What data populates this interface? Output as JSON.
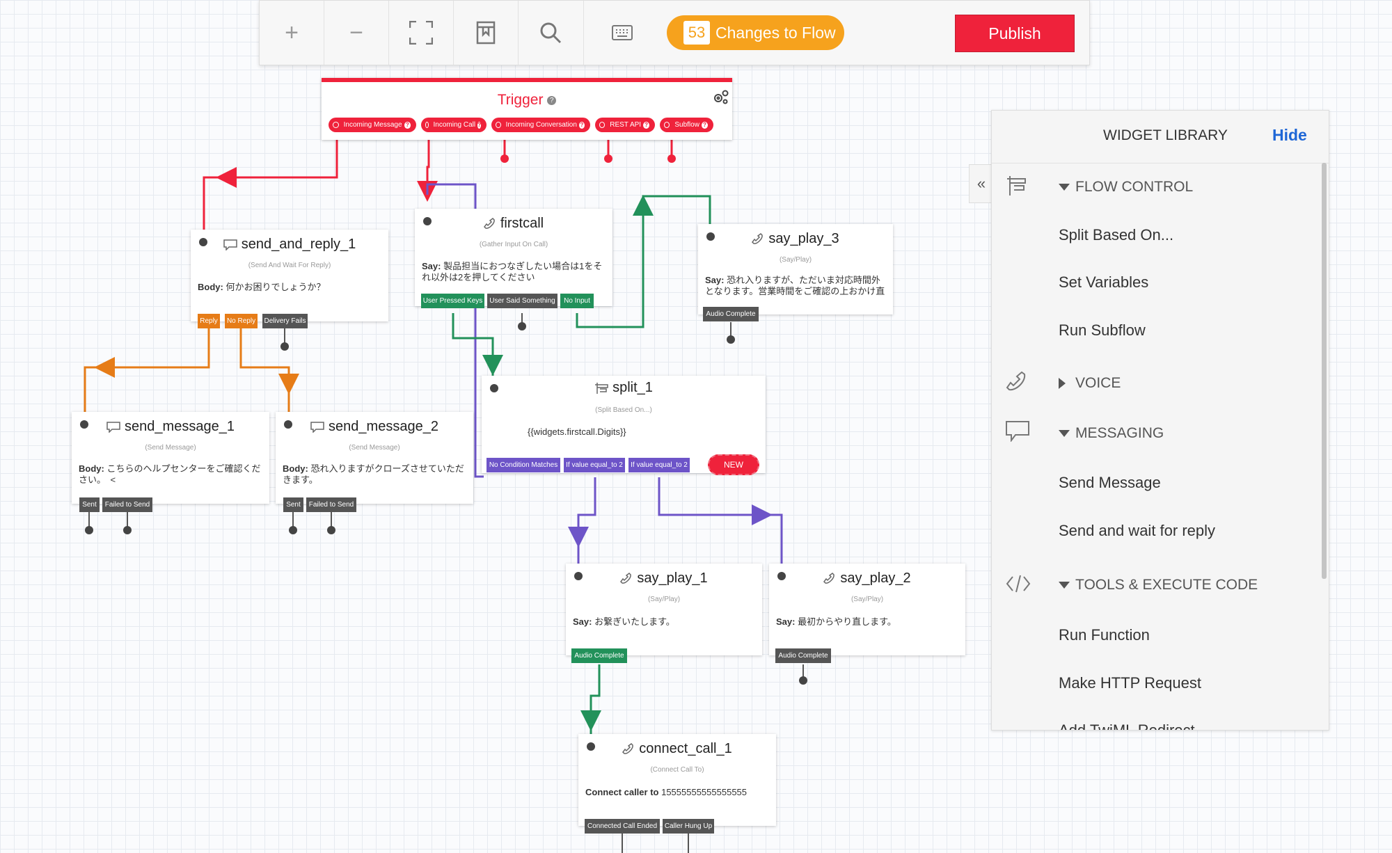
{
  "toolbar": {
    "zoom_in": "+",
    "zoom_out": "−",
    "changes_count": "53",
    "changes_label": "Changes to Flow",
    "publish_label": "Publish"
  },
  "trigger": {
    "title": "Trigger",
    "pills": [
      "Incoming Message",
      "Incoming Call",
      "Incoming Conversation",
      "REST API",
      "Subflow"
    ]
  },
  "widgets": {
    "send_and_reply_1": {
      "name": "send_and_reply_1",
      "type": "(Send And Wait For Reply)",
      "body_label": "Body:",
      "body_text": "何かお困りでしょうか？",
      "ports": [
        "Reply",
        "No Reply",
        "Delivery Fails"
      ]
    },
    "firstcall": {
      "name": "firstcall",
      "type": "(Gather Input On Call)",
      "body_label": "Say:",
      "body_text": "製品担当におつなぎしたい場合は1をそれ以外は2を押してください",
      "ports": [
        "User Pressed Keys",
        "User Said Something",
        "No Input"
      ]
    },
    "say_play_3": {
      "name": "say_play_3",
      "type": "(Say/Play)",
      "body_label": "Say:",
      "body_text": "恐れ入りますが、ただいま対応時間外となります。営業時間をご確認の上おかけ直",
      "ports": [
        "Audio Complete"
      ]
    },
    "split_1": {
      "name": "split_1",
      "type": "(Split Based On...)",
      "body_text": "{{widgets.firstcall.Digits}}",
      "ports": [
        "No Condition Matches",
        "If value equal_to 2",
        "If value equal_to 2"
      ],
      "new_label": "NEW"
    },
    "send_message_1": {
      "name": "send_message_1",
      "type": "(Send Message)",
      "body_label": "Body:",
      "body_text": "こちらのヘルプセンターをご確認ください。　<",
      "ports": [
        "Sent",
        "Failed to Send"
      ]
    },
    "send_message_2": {
      "name": "send_message_2",
      "type": "(Send Message)",
      "body_label": "Body:",
      "body_text": "恐れ入りますがクローズさせていただきます。",
      "ports": [
        "Sent",
        "Failed to Send"
      ]
    },
    "say_play_1": {
      "name": "say_play_1",
      "type": "(Say/Play)",
      "body_label": "Say:",
      "body_text": "お繋ぎいたします。",
      "ports": [
        "Audio Complete"
      ]
    },
    "say_play_2": {
      "name": "say_play_2",
      "type": "(Say/Play)",
      "body_label": "Say:",
      "body_text": "最初からやり直します。",
      "ports": [
        "Audio Complete"
      ]
    },
    "connect_call_1": {
      "name": "connect_call_1",
      "type": "(Connect Call To)",
      "body_label": "Connect caller to",
      "body_text": "15555555555555555",
      "ports": [
        "Connected Call Ended",
        "Caller Hung Up"
      ]
    }
  },
  "library": {
    "title": "WIDGET LIBRARY",
    "hide_label": "Hide",
    "collapse_glyph": "«",
    "categories": [
      {
        "label": "FLOW CONTROL",
        "items": [
          "Split Based On...",
          "Set Variables",
          "Run Subflow"
        ]
      },
      {
        "label": "VOICE",
        "items": []
      },
      {
        "label": "MESSAGING",
        "items": [
          "Send Message",
          "Send and wait for reply"
        ]
      },
      {
        "label": "TOOLS & EXECUTE CODE",
        "items": [
          "Run Function",
          "Make HTTP Request",
          "Add TwiML Redirect"
        ]
      }
    ]
  },
  "colors": {
    "red": "#ef223b",
    "orange": "#e67c17",
    "green": "#22915a",
    "purple": "#6d54c8",
    "amber": "#f6a21d",
    "blue": "#1e66d6"
  }
}
